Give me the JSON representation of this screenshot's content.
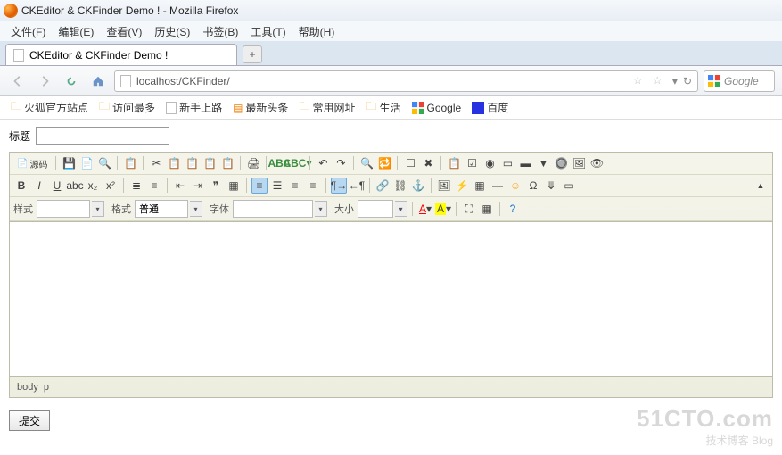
{
  "window_title": "CKEditor & CKFinder Demo ! - Mozilla Firefox",
  "menubar": [
    "文件(F)",
    "编辑(E)",
    "查看(V)",
    "历史(S)",
    "书签(B)",
    "工具(T)",
    "帮助(H)"
  ],
  "tab_title": "CKEditor & CKFinder Demo !",
  "url": "localhost/CKFinder/",
  "search_placeholder": "Google",
  "bookmarks": [
    "火狐官方站点",
    "访问最多",
    "新手上路",
    "最新头条",
    "常用网址",
    "生活",
    "Google",
    "百度"
  ],
  "title_label": "标题",
  "source_btn": "源码",
  "style_label": "样式",
  "format_label": "格式",
  "format_value": "普通",
  "font_label": "字体",
  "size_label": "大小",
  "status_path": [
    "body",
    "p"
  ],
  "submit_label": "提交",
  "watermark_big": "51CTO.com",
  "watermark_small1": "技术博客",
  "watermark_small2": "Blog"
}
